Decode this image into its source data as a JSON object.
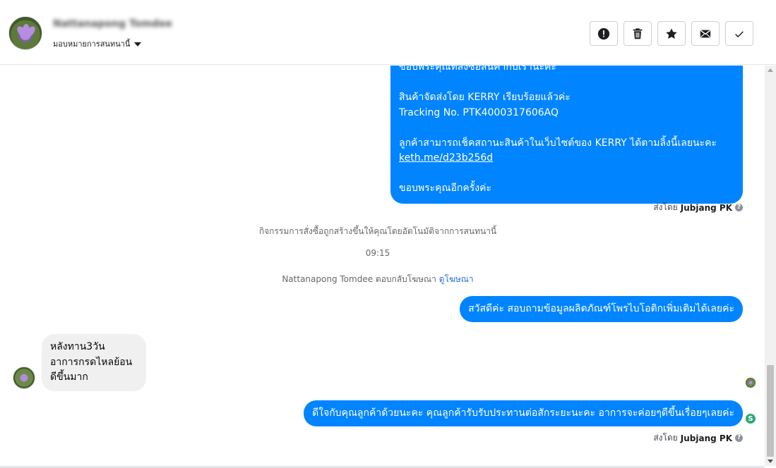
{
  "header": {
    "contact_name": "Nattanapong Tomdee",
    "assign_label": "มอบหมายการสนทนานี้",
    "actions": [
      {
        "name": "report-button",
        "icon": "alert-icon"
      },
      {
        "name": "delete-button",
        "icon": "trash-icon"
      },
      {
        "name": "star-button",
        "icon": "star-icon"
      },
      {
        "name": "mark-unread-button",
        "icon": "envelope-icon"
      },
      {
        "name": "mark-done-button",
        "icon": "check-icon"
      }
    ]
  },
  "messages": {
    "big_bubble": {
      "line_top": "ขอบพระคุณที่สั่งซื้อสินค้ากับเรานะคะ",
      "line_shipped": "สินค้าจัดส่งโดย KERRY เรียบร้อยแล้วค่ะ",
      "line_tracking": "Tracking No. PTK4000317606AQ",
      "line_check": "ลูกค้าสามารถเช็คสถานะสินค้าในเว็บไซต์ของ KERRY ได้ตามลิ้งนี้เลยนะคะ",
      "link": "keth.me/d23b256d",
      "line_thanks": "ขอบพระคุณอีกครั้งค่ะ"
    },
    "sent_by_1": {
      "prefix": "ส่งโดย",
      "agent": "Jubjang PK"
    },
    "system_order": "กิจกรรมการสั่งซื้อถูกสร้างขึ้นให้คุณโดยอัตโนมัติจากการสนทนานี้",
    "time": "09:15",
    "system_ad": {
      "text": "Nattanapong Tomdee ตอบกลับโฆษณา",
      "link": "ดูโฆษณา"
    },
    "outgoing_1": "สวัสดีค่ะ สอบถามข้อมูลผลิตภัณฑ์โพรไบโอติกเพิ่มเติมได้เลยค่ะ",
    "incoming_1": [
      "หลังทาน3วัน",
      "อาการกรดไหลย้อน",
      "ดีขึ้นมาก"
    ],
    "outgoing_2": "ดีใจกับคุณลูกค้าด้วยนะคะ คุณลูกค้ารับรับประทานต่อสักระยะนะคะ อาการจะค่อยๆดีขึ้นเรื่อยๆเลยค่ะ",
    "sent_by_2": {
      "prefix": "ส่งโดย",
      "agent": "Jubjang PK"
    },
    "help_icon": "?",
    "page_badge": "S"
  },
  "colors": {
    "outgoing_bubble": "#0084ff",
    "incoming_bubble": "#f0f0f0",
    "link": "#216fdb"
  }
}
